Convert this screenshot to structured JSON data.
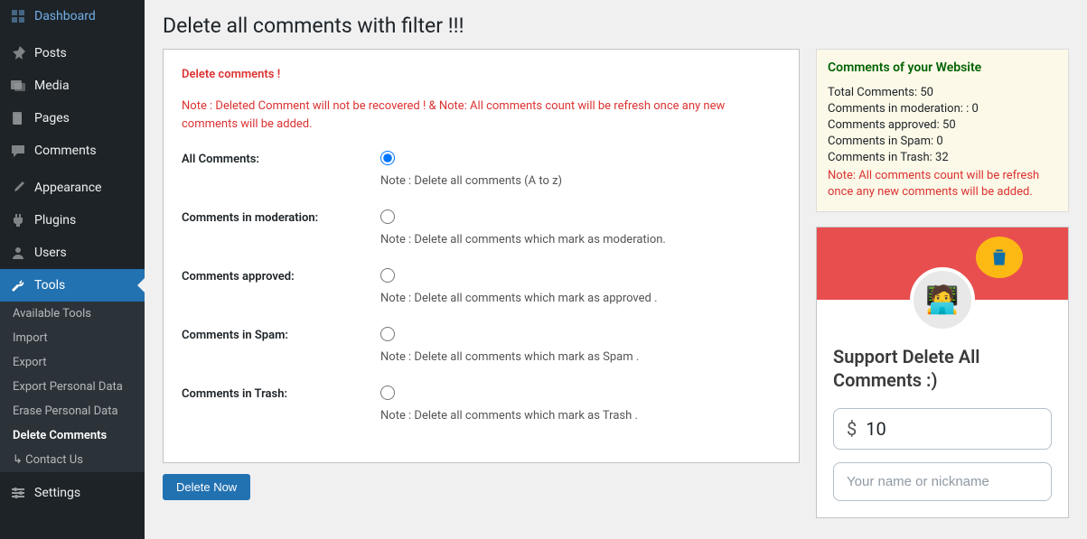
{
  "sidebar": {
    "items": [
      {
        "label": "Dashboard",
        "icon": "dashboard"
      },
      {
        "label": "Posts",
        "icon": "pin"
      },
      {
        "label": "Media",
        "icon": "media"
      },
      {
        "label": "Pages",
        "icon": "page"
      },
      {
        "label": "Comments",
        "icon": "comment"
      },
      {
        "label": "Appearance",
        "icon": "brush"
      },
      {
        "label": "Plugins",
        "icon": "plug"
      },
      {
        "label": "Users",
        "icon": "user"
      },
      {
        "label": "Tools",
        "icon": "wrench"
      },
      {
        "label": "Settings",
        "icon": "gear"
      }
    ],
    "submenu": [
      "Available Tools",
      "Import",
      "Export",
      "Export Personal Data",
      "Erase Personal Data",
      "Delete Comments",
      "↳ Contact Us"
    ]
  },
  "page_title": "Delete all comments with filter !!!",
  "form": {
    "title": "Delete comments !",
    "note": "Note : Deleted Comment will not be recovered ! & Note: All comments count will be refresh once any new comments will be added.",
    "options": [
      {
        "label": "All Comments:",
        "note": "Note : Delete all comments (A to z)",
        "checked": true
      },
      {
        "label": "Comments in moderation:",
        "note": "Note : Delete all comments which mark as moderation.",
        "checked": false
      },
      {
        "label": "Comments approved:",
        "note": "Note : Delete all comments which mark as approved .",
        "checked": false
      },
      {
        "label": "Comments in Spam:",
        "note": "Note : Delete all comments which mark as Spam .",
        "checked": false
      },
      {
        "label": "Comments in Trash:",
        "note": "Note : Delete all comments which mark as Trash .",
        "checked": false
      }
    ],
    "submit": "Delete Now"
  },
  "stats": {
    "title": "Comments of your Website",
    "rows": [
      {
        "label": "Total Comments:",
        "value": "50"
      },
      {
        "label": "Comments in moderation: :",
        "value": "0"
      },
      {
        "label": "Comments approved:",
        "value": "50"
      },
      {
        "label": "Comments in Spam:",
        "value": "0"
      },
      {
        "label": "Comments in Trash:",
        "value": "32"
      }
    ],
    "note": "Note: All comments count will be refresh once any new comments will be added."
  },
  "support": {
    "title": "Support Delete All Comments :)",
    "currency": "$",
    "amount": "10",
    "name_placeholder": "Your name or nickname"
  }
}
